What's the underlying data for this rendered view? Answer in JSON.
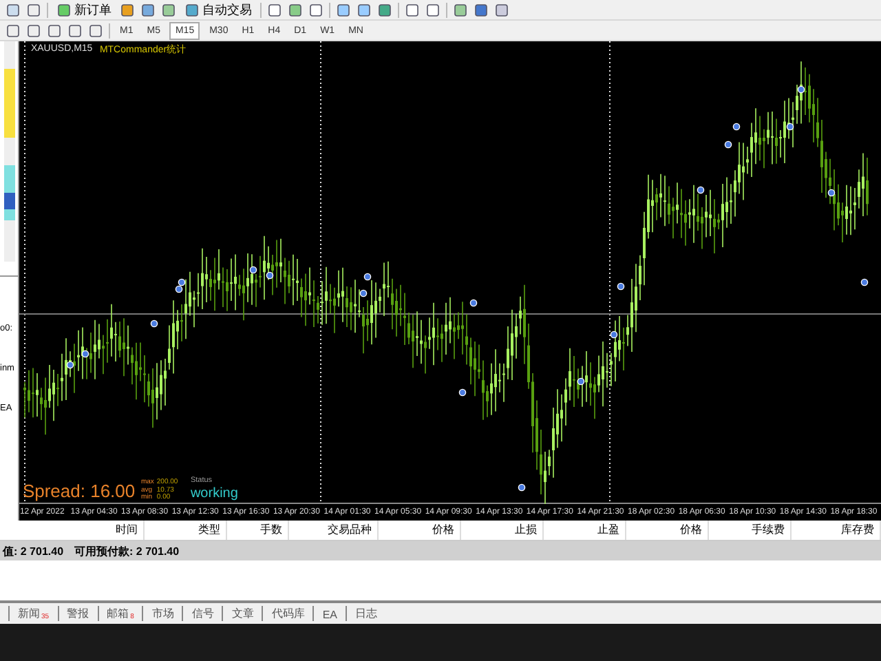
{
  "toolbar": {
    "buttons": [
      {
        "label": "新订单"
      },
      {
        "label": "自动交易"
      }
    ]
  },
  "timeframes": [
    {
      "label": "M1",
      "selected": false
    },
    {
      "label": "M5",
      "selected": false
    },
    {
      "label": "M15",
      "selected": true
    },
    {
      "label": "M30",
      "selected": false
    },
    {
      "label": "H1",
      "selected": false
    },
    {
      "label": "H4",
      "selected": false
    },
    {
      "label": "D1",
      "selected": false
    },
    {
      "label": "W1",
      "selected": false
    },
    {
      "label": "MN",
      "selected": false
    }
  ],
  "left_panel": {
    "texts": [
      "o0:",
      "inm",
      "EA"
    ]
  },
  "chart": {
    "symbol": "XAUUSD,M15",
    "indicator": "MTCommander统计",
    "spread": "Spread: 16.00",
    "stats": [
      {
        "label": "max",
        "value": "200.00"
      },
      {
        "label": "avg",
        "value": "10.73"
      },
      {
        "label": "min",
        "value": "0.00"
      }
    ],
    "status_label": "Status",
    "status": "working",
    "time_labels": [
      "12 Apr 2022",
      "13 Apr 04:30",
      "13 Apr 08:30",
      "13 Apr 12:30",
      "13 Apr 16:30",
      "13 Apr 20:30",
      "14 Apr 01:30",
      "14 Apr 05:30",
      "14 Apr 09:30",
      "14 Apr 13:30",
      "14 Apr 17:30",
      "14 Apr 21:30",
      "18 Apr 02:30",
      "18 Apr 06:30",
      "18 Apr 10:30",
      "18 Apr 14:30",
      "18 Apr 18:30"
    ]
  },
  "table": {
    "columns": [
      "时间",
      "类型",
      "手数",
      "交易品种",
      "价格",
      "止损",
      "止盈",
      "价格",
      "手续费",
      "库存费"
    ]
  },
  "account": [
    "值: 2 701.40",
    "可用预付款: 2 701.40"
  ],
  "tabs": [
    {
      "label": "新闻",
      "badge": "35"
    },
    {
      "label": "警报"
    },
    {
      "label": "邮箱",
      "badge": "8"
    },
    {
      "label": "市场"
    },
    {
      "label": "信号"
    },
    {
      "label": "文章"
    },
    {
      "label": "代码库"
    },
    {
      "label": "EA"
    },
    {
      "label": "日志"
    }
  ]
}
